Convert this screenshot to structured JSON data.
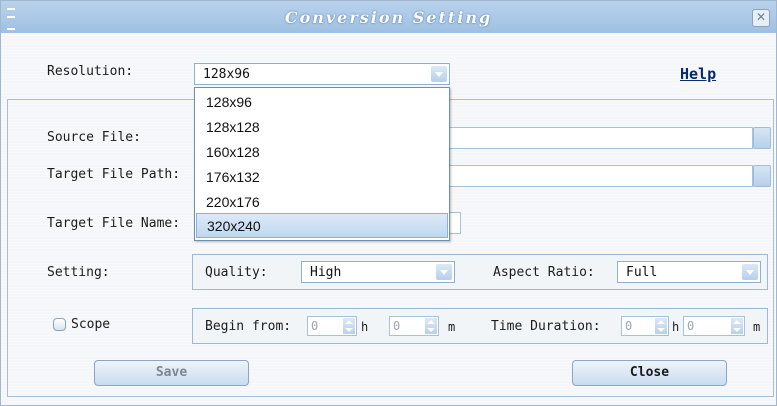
{
  "window": {
    "title": "Conversion Setting",
    "close_glyph": "✕"
  },
  "resolution": {
    "label": "Resolution:",
    "selected": "128x96",
    "options": [
      "128x96",
      "128x128",
      "160x128",
      "176x132",
      "220x176",
      "320x240"
    ],
    "highlighted_index": 5
  },
  "help_label": "Help",
  "source_file": {
    "label": "Source File:",
    "value": ""
  },
  "target_path": {
    "label": "Target File Path:",
    "value": ""
  },
  "target_name": {
    "label": "Target File Name:",
    "value": ""
  },
  "setting": {
    "label": "Setting:",
    "quality_label": "Quality:",
    "quality_value": "High",
    "aspect_label": "Aspect Ratio:",
    "aspect_value": "Full"
  },
  "scope": {
    "label": "Scope",
    "checked": false,
    "begin_label": "Begin from:",
    "begin_h": "0",
    "begin_m": "0",
    "h_unit": "h",
    "m_unit": "m",
    "duration_label": "Time Duration:",
    "duration_h": "0",
    "duration_m": "0"
  },
  "buttons": {
    "save": "Save",
    "close": "Close"
  },
  "colors": {
    "titlebar": "#a9c8e8",
    "accent": "#8fb0d0",
    "help_link": "#0a2b6b",
    "save_text": "#7b8794"
  },
  "icons": {
    "close": "close-icon",
    "grip": "grip-icon",
    "dropdown": "chevron-down-icon",
    "browse": "browse-icon",
    "spinner": "spinner-icon"
  }
}
